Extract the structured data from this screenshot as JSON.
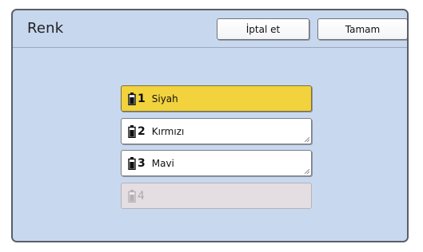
{
  "dialog": {
    "title": "Renk",
    "cancel_label": "İptal et",
    "ok_label": "Tamam"
  },
  "options": [
    {
      "number": "1",
      "label": "Siyah",
      "state": "selected"
    },
    {
      "number": "2",
      "label": "Kırmızı",
      "state": "normal"
    },
    {
      "number": "3",
      "label": "Mavi",
      "state": "normal"
    },
    {
      "number": "4",
      "label": "",
      "state": "disabled"
    }
  ],
  "icons": {
    "ink": "ink-cartridge-icon"
  },
  "colors": {
    "panel": "#c7d7ee",
    "selected": "#f2d23d",
    "disabled": "#e4dde1"
  }
}
